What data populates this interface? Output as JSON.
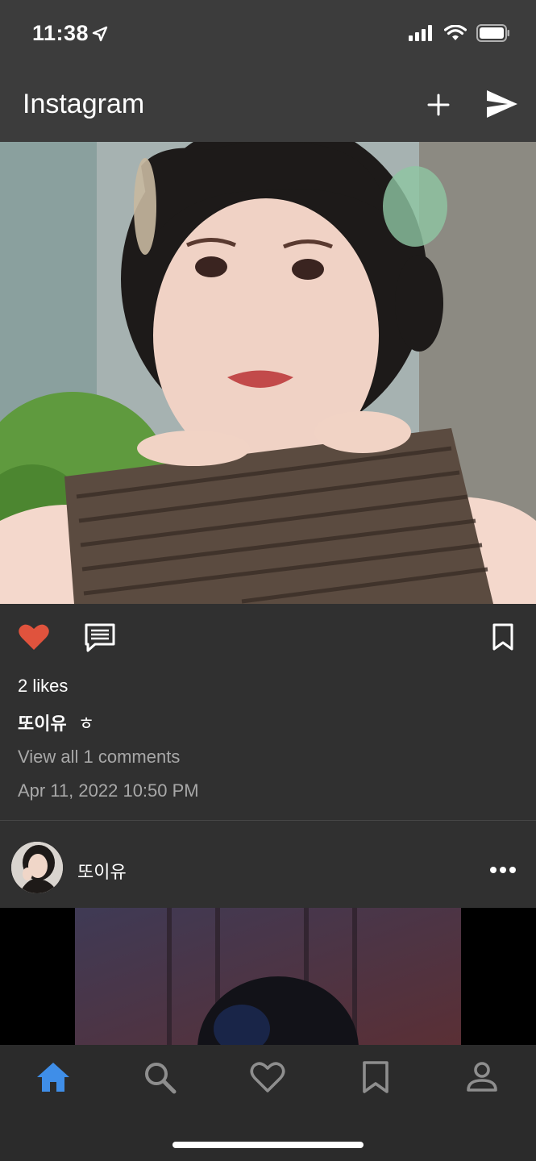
{
  "status_bar": {
    "time": "11:38"
  },
  "app_bar": {
    "title": "Instagram"
  },
  "post1": {
    "likes": "2 likes",
    "caption_user": "또이유",
    "caption_text": "ㅎ",
    "view_comments": "View all 1 comments",
    "date": "Apr 11, 2022 10:50 PM",
    "liked": true
  },
  "post2": {
    "username": "또이유"
  },
  "colors": {
    "background": "#303030",
    "bar": "#3c3c3c",
    "like_red": "#e0533d",
    "nav_active": "#3f8ee8",
    "nav_inactive": "#8e8e8e",
    "muted_text": "#a8a8a8"
  },
  "icons": {
    "app_bar": [
      "plus-icon",
      "send-icon"
    ],
    "post_actions": [
      "heart-icon",
      "comment-icon",
      "bookmark-icon"
    ],
    "post_header": [
      "more-dots-icon"
    ],
    "bottom_nav": [
      "home-icon",
      "search-icon",
      "heart-outline-icon",
      "bookmark-outline-icon",
      "person-icon"
    ]
  }
}
